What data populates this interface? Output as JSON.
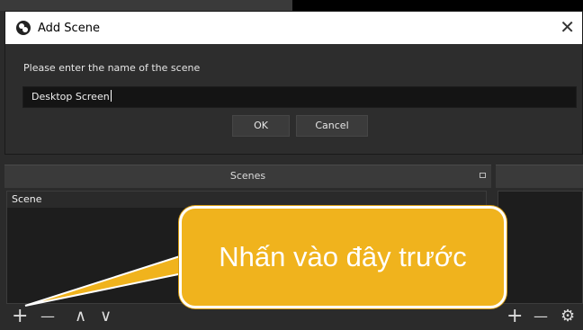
{
  "dialog": {
    "title": "Add Scene",
    "close_glyph": "✕",
    "prompt": "Please enter the name of the scene",
    "name_value": "Desktop Screen",
    "ok_label": "OK",
    "cancel_label": "Cancel"
  },
  "scenes_dock": {
    "title": "Scenes",
    "items": [
      {
        "label": "Scene"
      }
    ],
    "toolbar": {
      "add": "+",
      "remove": "—",
      "up": "∧",
      "down": "∨"
    }
  },
  "right_dock": {
    "toolbar": {
      "add": "+",
      "remove": "—",
      "settings": "⚙"
    }
  },
  "callout": {
    "text": "Nhấn vào đây trước",
    "color": "#f0b31d"
  }
}
